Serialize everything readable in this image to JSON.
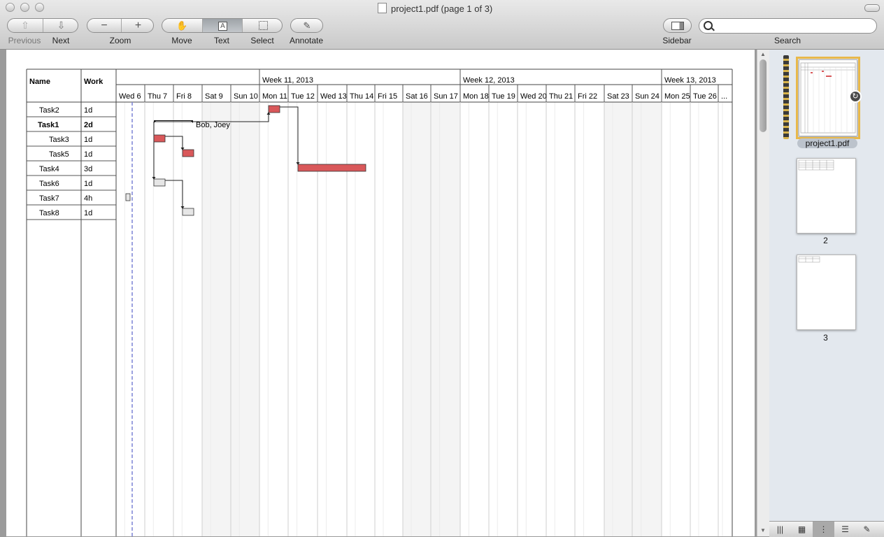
{
  "window": {
    "title": "project1.pdf (page 1 of 3)"
  },
  "toolbar": {
    "previous_label": "Previous",
    "next_label": "Next",
    "zoom_label": "Zoom",
    "move_label": "Move",
    "text_label": "Text",
    "select_label": "Select",
    "annotate_label": "Annotate",
    "sidebar_label": "Sidebar",
    "search_label": "Search",
    "search_value": "",
    "selected_tool": "Text",
    "icons": [
      "up-arrow-icon",
      "down-arrow-icon",
      "zoom-out-icon",
      "zoom-in-icon",
      "hand-icon",
      "text-cursor-icon",
      "marquee-icon",
      "pencil-icon",
      "sidebar-icon",
      "search-icon"
    ]
  },
  "gantt": {
    "headers": {
      "name": "Name",
      "work": "Work"
    },
    "weeks": [
      "Week 11, 2013",
      "Week 12, 2013",
      "Week 13, 2013"
    ],
    "days": [
      "Wed 6",
      "Thu 7",
      "Fri 8",
      "Sat 9",
      "Sun 10",
      "Mon 11",
      "Tue 12",
      "Wed 13",
      "Thu 14",
      "Fri 15",
      "Sat 16",
      "Sun 17",
      "Mon 18",
      "Tue 19",
      "Wed 20",
      "Thu 21",
      "Fri 22",
      "Sat 23",
      "Sun 24",
      "Mon 25",
      "Tue 26",
      "..."
    ],
    "tasks": [
      {
        "name": "Task2",
        "work": "1d",
        "bold": false,
        "indent": 0
      },
      {
        "name": "Task1",
        "work": "2d",
        "bold": true,
        "indent": 0
      },
      {
        "name": "Task3",
        "work": "1d",
        "bold": false,
        "indent": 1
      },
      {
        "name": "Task5",
        "work": "1d",
        "bold": false,
        "indent": 1
      },
      {
        "name": "Task4",
        "work": "3d",
        "bold": false,
        "indent": 0
      },
      {
        "name": "Task6",
        "work": "1d",
        "bold": false,
        "indent": 0
      },
      {
        "name": "Task7",
        "work": "4h",
        "bold": false,
        "indent": 0
      },
      {
        "name": "Task8",
        "work": "1d",
        "bold": false,
        "indent": 0
      }
    ],
    "resource_label": "Bob, Joey",
    "colors": {
      "critical": "#d9585a",
      "normal": "#e6e6e6",
      "today_line": "#7b84d6"
    }
  },
  "sidebar": {
    "pages": [
      {
        "label": "project1.pdf",
        "selected": true
      },
      {
        "label": "2",
        "selected": false
      },
      {
        "label": "3",
        "selected": false
      }
    ],
    "view_buttons": [
      "columns-icon",
      "grid-icon",
      "thumbnails-icon",
      "list-icon",
      "annotate-icon"
    ],
    "selected_view": "thumbnails-icon",
    "rotate_icon": "rotate-icon"
  }
}
